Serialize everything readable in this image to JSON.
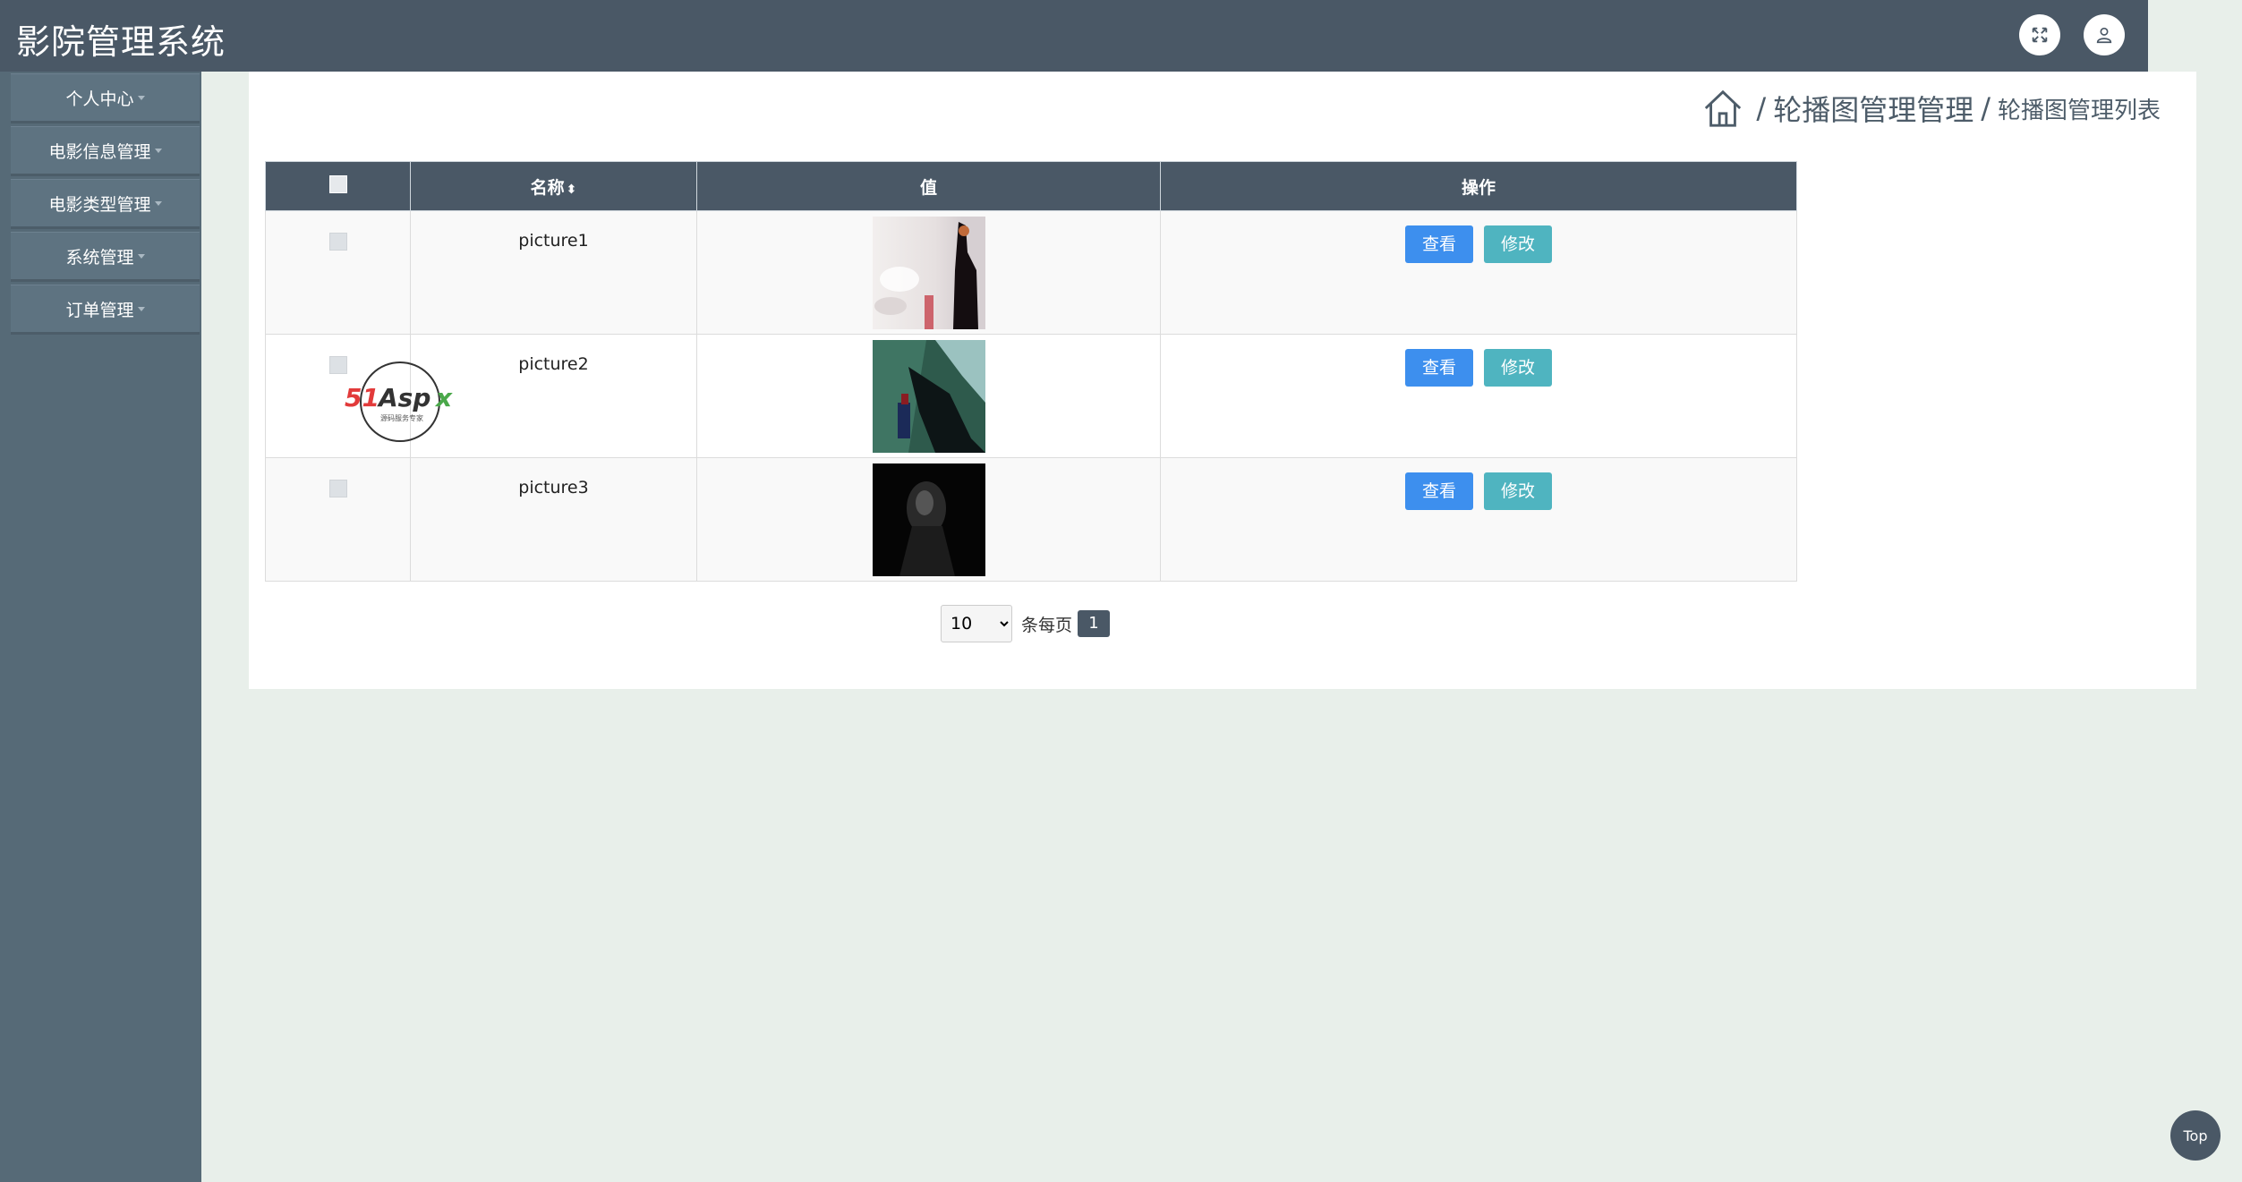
{
  "header": {
    "title": "影院管理系统",
    "fullscreen_icon": "expand-icon",
    "user_icon": "user-icon"
  },
  "sidebar": {
    "items": [
      {
        "label": "个人中心"
      },
      {
        "label": "电影信息管理"
      },
      {
        "label": "电影类型管理"
      },
      {
        "label": "系统管理"
      },
      {
        "label": "订单管理"
      }
    ]
  },
  "breadcrumb": {
    "home_icon": "home-icon",
    "level1": "轮播图管理管理",
    "level2": "轮播图管理列表",
    "separator": "/"
  },
  "table": {
    "headers": {
      "name": "名称",
      "value": "值",
      "actions": "操作",
      "sort_glyph": "⬍"
    },
    "rows": [
      {
        "name": "picture1",
        "view": "查看",
        "edit": "修改"
      },
      {
        "name": "picture2",
        "view": "查看",
        "edit": "修改"
      },
      {
        "name": "picture3",
        "view": "查看",
        "edit": "修改"
      }
    ]
  },
  "pagination": {
    "page_size": "10",
    "page_size_options": [
      "10"
    ],
    "per_page_label": "条每页",
    "current_page": "1"
  },
  "watermark": {
    "text": "51Aspx",
    "subtext": "源码服务专家"
  },
  "back_to_top": {
    "label": "Top"
  },
  "colors": {
    "header_bg": "#4a5866",
    "sidebar_bg": "#566a77",
    "view_button": "#3d8fee",
    "edit_button": "#4fb4c0"
  }
}
